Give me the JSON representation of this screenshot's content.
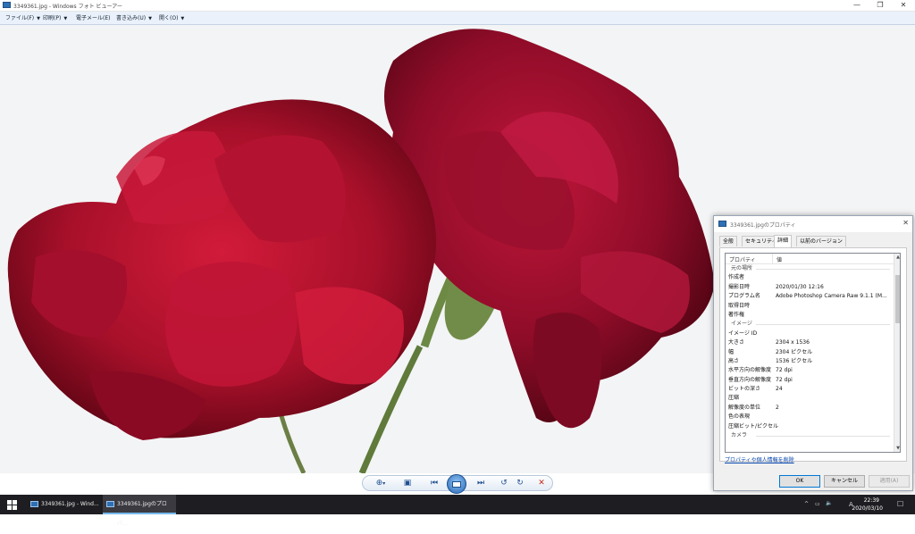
{
  "window": {
    "title": "3349361.jpg - Windows フォト ビューアー",
    "minimize": "—",
    "maximize": "❐",
    "close": "✕"
  },
  "menu": [
    {
      "label": "ファイル(F)",
      "arrow": "▼"
    },
    {
      "label": "印刷(P)",
      "arrow": "▼"
    },
    {
      "label": "電子メール(E)",
      "arrow": ""
    },
    {
      "label": "書き込み(U)",
      "arrow": "▼"
    },
    {
      "label": "開く(O)",
      "arrow": "▼"
    }
  ],
  "toolbar": {
    "zoom_icon": "⊕",
    "zoom_arrow": "▾",
    "actual_size_icon": "▣",
    "prev_icon": "⏮",
    "slideshow_icon": "▭",
    "next_icon": "⏭",
    "rotate_ccw_icon": "↺",
    "rotate_cw_icon": "↻",
    "delete_icon": "✕"
  },
  "photo": {
    "subject": "red-roses",
    "colors": {
      "petal_dark": "#7a0a1a",
      "petal_mid": "#b3122b",
      "petal_light": "#d21b3a",
      "stem": "#5f7a3a",
      "background": "#f3f4f5"
    }
  },
  "dialog": {
    "title": "3349361.jpgのプロパティ",
    "close": "✕",
    "tabs": [
      {
        "label": "全般",
        "active": false
      },
      {
        "label": "セキュリティ",
        "active": false
      },
      {
        "label": "詳細",
        "active": true
      },
      {
        "label": "以前のバージョン",
        "active": false
      }
    ],
    "columns": {
      "property": "プロパティ",
      "value": "値"
    },
    "rows": [
      {
        "key": "元の場所",
        "value": "",
        "group": true
      },
      {
        "key": "作成者",
        "value": ""
      },
      {
        "key": "撮影日時",
        "value": "2020/01/30 12:16"
      },
      {
        "key": "プログラム名",
        "value": "Adobe Photoshop Camera Raw 9.1.1 (M..."
      },
      {
        "key": "取得日時",
        "value": ""
      },
      {
        "key": "著作権",
        "value": ""
      },
      {
        "key": "イメージ",
        "value": "",
        "group": true
      },
      {
        "key": "イメージ ID",
        "value": ""
      },
      {
        "key": "大きさ",
        "value": "2304 x 1536"
      },
      {
        "key": "幅",
        "value": "2304 ピクセル"
      },
      {
        "key": "高さ",
        "value": "1536 ピクセル"
      },
      {
        "key": "水平方向の解像度",
        "value": "72 dpi"
      },
      {
        "key": "垂直方向の解像度",
        "value": "72 dpi"
      },
      {
        "key": "ビットの深さ",
        "value": "24"
      },
      {
        "key": "圧縮",
        "value": ""
      },
      {
        "key": "解像度の単位",
        "value": "2"
      },
      {
        "key": "色の表現",
        "value": ""
      },
      {
        "key": "圧縮ビット/ピクセル",
        "value": ""
      },
      {
        "key": "カメラ",
        "value": "",
        "group": true
      }
    ],
    "remove_link": "プロパティや個人情報を削除",
    "buttons": {
      "ok": "OK",
      "cancel": "キャンセル",
      "apply": "適用(A)"
    }
  },
  "taskbar": {
    "items": [
      {
        "label": "3349361.jpg - Wind...",
        "active": false
      },
      {
        "label": "3349361.jpgのプロパ...",
        "active": true
      }
    ],
    "tray": {
      "chevron": "^",
      "network": "▭",
      "volume": "🔈",
      "ime": "A"
    },
    "time": "22:39",
    "date": "2020/03/10",
    "notification": "☐"
  }
}
